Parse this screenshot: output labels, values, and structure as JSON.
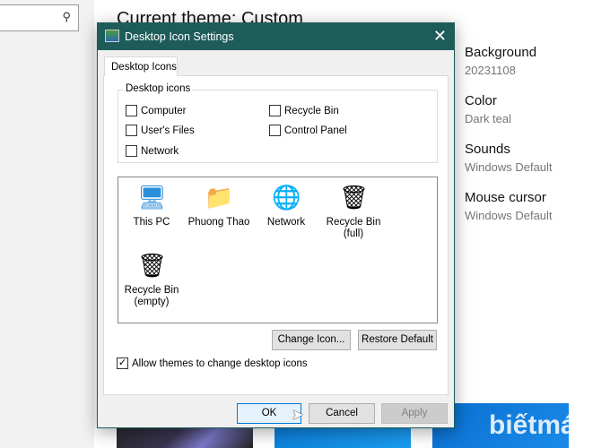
{
  "background_page": {
    "title": "Current theme: Custom",
    "items": [
      {
        "heading": "Background",
        "value": "20231108"
      },
      {
        "heading": "Color",
        "value": "Dark teal"
      },
      {
        "heading": "Sounds",
        "value": "Windows Default"
      },
      {
        "heading": "Mouse cursor",
        "value": "Windows Default"
      }
    ]
  },
  "dialog": {
    "title": "Desktop Icon Settings",
    "tab": "Desktop Icons",
    "group_label": "Desktop icons",
    "checkboxes": [
      {
        "label": "Computer",
        "checked": false
      },
      {
        "label": "Recycle Bin",
        "checked": false
      },
      {
        "label": "User's Files",
        "checked": false
      },
      {
        "label": "Control Panel",
        "checked": false
      },
      {
        "label": "Network",
        "checked": false
      }
    ],
    "icons": [
      {
        "line1": "This PC",
        "line2": ""
      },
      {
        "line1": "Phuong Thao",
        "line2": ""
      },
      {
        "line1": "Network",
        "line2": ""
      },
      {
        "line1": "Recycle Bin",
        "line2": "(full)"
      },
      {
        "line1": "Recycle Bin",
        "line2": "(empty)"
      }
    ],
    "change_icon": "Change Icon...",
    "restore_default": "Restore Default",
    "allow_themes": {
      "label": "Allow themes to change desktop icons",
      "checked": true
    },
    "ok": "OK",
    "cancel": "Cancel",
    "apply": "Apply"
  },
  "watermark": "biếtmáytính",
  "colors": {
    "titlebar": "#1e5c5a"
  }
}
